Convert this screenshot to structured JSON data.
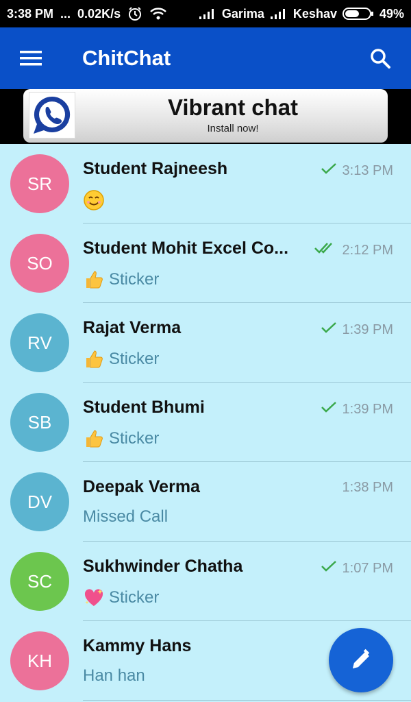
{
  "status_bar": {
    "time": "3:38 PM",
    "dots": "...",
    "speed": "0.02K/s",
    "carrier1": "Garima",
    "carrier2": "Keshav",
    "battery": "49%"
  },
  "app_bar": {
    "title": "ChitChat"
  },
  "ad": {
    "title": "Vibrant chat",
    "subtitle": "Install now!"
  },
  "colors": {
    "appbar": "#0a50c8",
    "background": "#c4f0fb",
    "fab": "#1563d6",
    "check": "#3aa84a"
  },
  "chats": [
    {
      "initials": "SR",
      "name": "Student Rajneesh",
      "time": "3:13 PM",
      "status": "sent",
      "preview": "",
      "preview_icon": "smiley-icon",
      "avatar_color": "#ec7199"
    },
    {
      "initials": "SO",
      "name": "Student Mohit Excel Co...",
      "time": "2:12 PM",
      "status": "read",
      "preview": "Sticker",
      "preview_icon": "thumbs-up-icon",
      "avatar_color": "#ec7199"
    },
    {
      "initials": "RV",
      "name": "Rajat Verma",
      "time": "1:39 PM",
      "status": "sent",
      "preview": "Sticker",
      "preview_icon": "thumbs-up-icon",
      "avatar_color": "#5bb4d0"
    },
    {
      "initials": "SB",
      "name": "Student Bhumi",
      "time": "1:39 PM",
      "status": "sent",
      "preview": "Sticker",
      "preview_icon": "thumbs-up-icon",
      "avatar_color": "#5bb4d0"
    },
    {
      "initials": "DV",
      "name": "Deepak Verma",
      "time": "1:38 PM",
      "status": "none",
      "preview": "Missed Call",
      "preview_icon": "",
      "avatar_color": "#5bb4d0"
    },
    {
      "initials": "SC",
      "name": "Sukhwinder Chatha",
      "time": "1:07 PM",
      "status": "sent",
      "preview": "Sticker",
      "preview_icon": "sparkling-heart-icon",
      "avatar_color": "#6cc64e"
    },
    {
      "initials": "KH",
      "name": "Kammy Hans",
      "time": "",
      "status": "none",
      "preview": "Han han",
      "preview_icon": "",
      "avatar_color": "#ec7199"
    }
  ]
}
